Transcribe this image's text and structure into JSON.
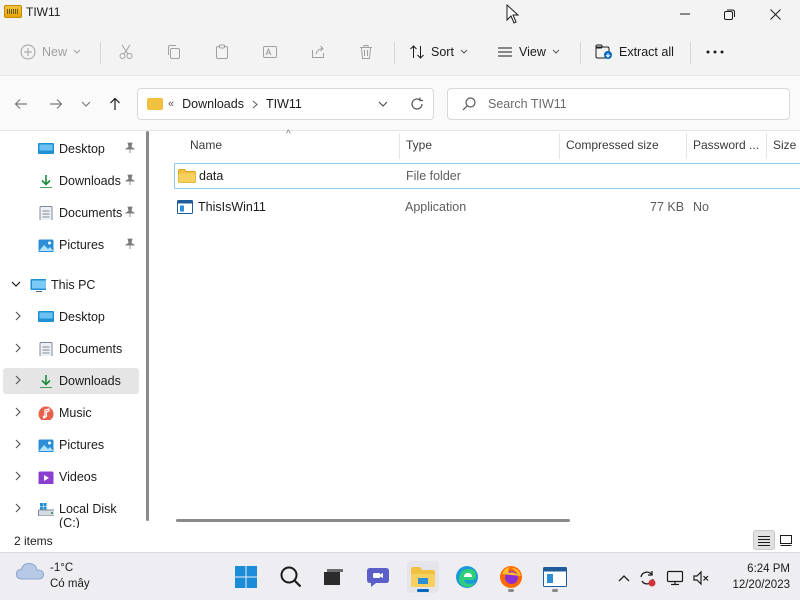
{
  "window": {
    "title": "TIW11"
  },
  "commandbar": {
    "new_label": "New",
    "sort_label": "Sort",
    "view_label": "View",
    "extract_label": "Extract all"
  },
  "address": {
    "overflow": "«",
    "crumbs": [
      "Downloads",
      "TIW11"
    ],
    "search_placeholder": "Search TIW11"
  },
  "sidebar": {
    "quick_access": [
      {
        "label": "Desktop",
        "icon": "desktop-icon"
      },
      {
        "label": "Downloads",
        "icon": "download-icon"
      },
      {
        "label": "Documents",
        "icon": "documents-icon"
      },
      {
        "label": "Pictures",
        "icon": "pictures-icon"
      }
    ],
    "this_pc_label": "This PC",
    "this_pc_items": [
      {
        "label": "Desktop",
        "icon": "desktop-icon"
      },
      {
        "label": "Documents",
        "icon": "documents-icon"
      },
      {
        "label": "Downloads",
        "icon": "download-icon",
        "selected": true
      },
      {
        "label": "Music",
        "icon": "music-icon"
      },
      {
        "label": "Pictures",
        "icon": "pictures-icon"
      },
      {
        "label": "Videos",
        "icon": "videos-icon"
      },
      {
        "label": "Local Disk (C:)",
        "icon": "drive-icon"
      }
    ]
  },
  "filelist": {
    "columns": [
      "Name",
      "Type",
      "Compressed size",
      "Password ...",
      "Size"
    ],
    "rows": [
      {
        "name": "data",
        "type": "File folder",
        "compressed_size": "",
        "password": "",
        "icon": "folder-icon"
      },
      {
        "name": "ThisIsWin11",
        "type": "Application",
        "compressed_size": "77 KB",
        "password": "No",
        "icon": "application-icon"
      }
    ]
  },
  "status": {
    "item_count": "2 items"
  },
  "taskbar": {
    "weather_temp": "-1°C",
    "weather_condition": "Có mây",
    "time": "6:24 PM",
    "date": "12/20/2023"
  },
  "colors": {
    "accent": "#0067c0",
    "folder": "#f3c140",
    "selection_border": "#99c9ef"
  }
}
